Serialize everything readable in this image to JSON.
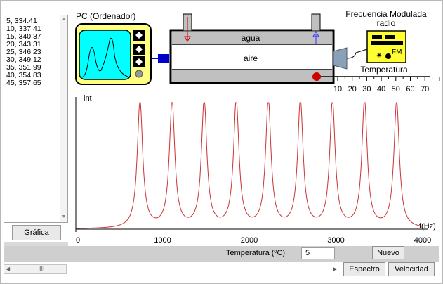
{
  "data_list": [
    "5, 334.41",
    "10, 337.41",
    "15, 340.37",
    "20, 343.31",
    "25, 346.23",
    "30, 349.12",
    "35, 351.99",
    "40, 354.83",
    "45, 357.65"
  ],
  "buttons": {
    "grafica": "Gráfica",
    "nuevo": "Nuevo",
    "espectro": "Espectro",
    "velocidad": "Velocidad"
  },
  "apparatus": {
    "pc_label": "PC (Ordenador)",
    "agua_label": "agua",
    "aire_label": "aire",
    "radio_title_line1": "Frecuencia Modulada",
    "radio_title_line2": "radio",
    "fm_label": "FM",
    "temp_scale_label": "Temperatura",
    "temp_scale_ticks": [
      "10",
      "20",
      "30",
      "40",
      "50",
      "60",
      "70"
    ]
  },
  "controls": {
    "temperature_label": "Temperatura (ºC)",
    "temperature_value": "5"
  },
  "scroll": {
    "thumb_glyph": "III"
  },
  "colors": {
    "pc_body": "#ffff80",
    "pc_screen": "#00ffff",
    "radio_body": "#ffff33",
    "peak_line": "#cc3333",
    "water": "#c0c0c0",
    "arrow_blue": "#3333ff",
    "arrow_red": "#cc0000"
  },
  "chart_data": {
    "type": "line",
    "ylabel": "int",
    "xlabel": "f(Hz)",
    "x_ticks": [
      0,
      1000,
      2000,
      3000,
      4000
    ],
    "xlim": [
      0,
      4000
    ],
    "series": [
      {
        "peaks_hz": [
          740,
          1110,
          1480,
          1850,
          2220,
          2590,
          2960,
          3330,
          3700
        ]
      }
    ]
  }
}
